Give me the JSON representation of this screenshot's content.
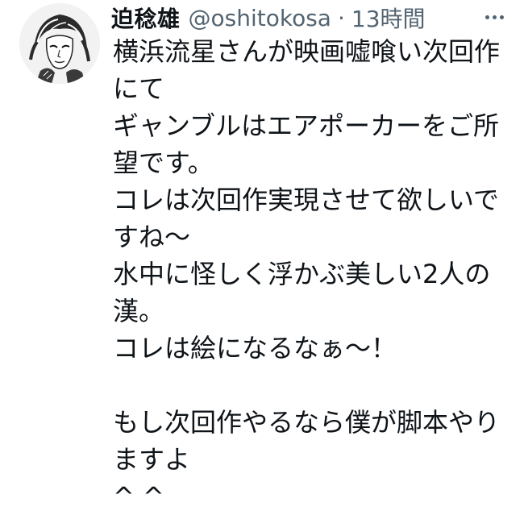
{
  "tweet": {
    "author": {
      "display_name": "迫稔雄",
      "handle": "@oshitokosa",
      "avatar_icon": "avatar-illustration-icon"
    },
    "separator": "·",
    "timestamp": "13時間",
    "more_icon": "more-options-icon",
    "lines": [
      "横浜流星さんが映画嘘喰い次回作",
      "にて",
      "ギャンブルはエアポーカーをご所",
      "望です。",
      "コレは次回作実現させて欲しいで",
      "すね〜",
      "水中に怪しく浮かぶ美しい2人の",
      "漢。",
      "コレは絵になるなぁ〜！",
      "",
      "もし次回作やるなら僕が脚本やり",
      "ますよ",
      "^ ^"
    ]
  }
}
